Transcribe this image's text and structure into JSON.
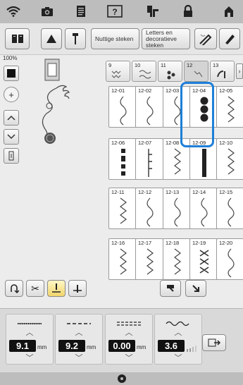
{
  "status_icons": [
    "wifi-icon",
    "camera-icon",
    "document-icon",
    "help-icon",
    "thread-spool-icon",
    "lock-icon",
    "home-icon"
  ],
  "tabs": {
    "utility": "Nuttige steken",
    "letters": "Letters en decoratieve steken"
  },
  "zoom_label": "100%",
  "categories": [
    {
      "label": "9"
    },
    {
      "label": "10"
    },
    {
      "label": "11"
    },
    {
      "label": "12"
    },
    {
      "label": "13"
    }
  ],
  "stitches": [
    {
      "id": "12-01"
    },
    {
      "id": "12-02"
    },
    {
      "id": "12-03"
    },
    {
      "id": "12-04"
    },
    {
      "id": "12-05"
    },
    {
      "id": "12-06"
    },
    {
      "id": "12-07"
    },
    {
      "id": "12-08"
    },
    {
      "id": "12-09"
    },
    {
      "id": "12-10"
    },
    {
      "id": "12-11"
    },
    {
      "id": "12-12"
    },
    {
      "id": "12-13"
    },
    {
      "id": "12-14"
    },
    {
      "id": "12-15"
    },
    {
      "id": "12-16"
    },
    {
      "id": "12-17"
    },
    {
      "id": "12-18"
    },
    {
      "id": "12-19"
    },
    {
      "id": "12-20"
    }
  ],
  "selected_stitch": "12-04",
  "settings": [
    {
      "name": "density",
      "value": "9.1",
      "unit": "mm"
    },
    {
      "name": "length",
      "value": "9.2",
      "unit": "mm"
    },
    {
      "name": "spacing",
      "value": "0.00",
      "unit": "mm"
    },
    {
      "name": "width",
      "value": "3.6",
      "unit": ""
    }
  ],
  "accent_color": "#1e7fd8"
}
